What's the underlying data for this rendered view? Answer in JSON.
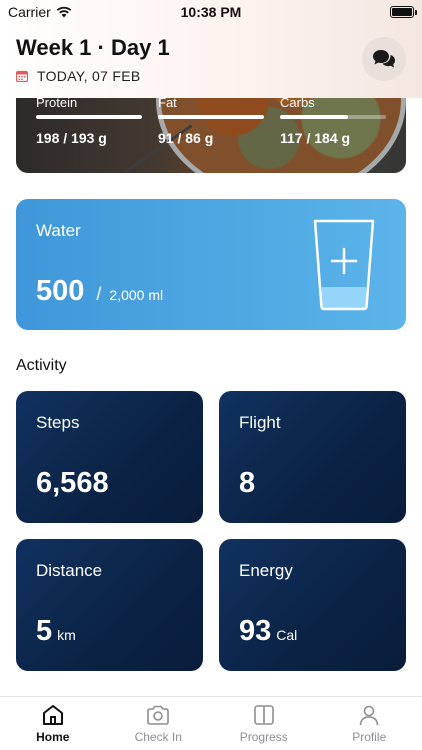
{
  "status_bar": {
    "carrier": "Carrier",
    "time": "10:38 PM"
  },
  "header": {
    "title": "Week 1 · Day 1",
    "date": "TODAY, 07 FEB"
  },
  "macros": [
    {
      "label": "Protein",
      "value": "198 / 193 g",
      "progress": 1.0
    },
    {
      "label": "Fat",
      "value": "91 / 86 g",
      "progress": 1.0
    },
    {
      "label": "Carbs",
      "value": "117 / 184 g",
      "progress": 0.64
    }
  ],
  "water": {
    "title": "Water",
    "amount": "500",
    "separator": "/",
    "target": "2,000 ml",
    "fill_fraction": 0.25
  },
  "activity": {
    "title": "Activity",
    "steps": {
      "label": "Steps",
      "value": "6,568",
      "unit": ""
    },
    "flight": {
      "label": "Flight",
      "value": "8",
      "unit": ""
    },
    "distance": {
      "label": "Distance",
      "value": "5",
      "unit": "km"
    },
    "energy": {
      "label": "Energy",
      "value": "93",
      "unit": "Cal"
    }
  },
  "tabs": [
    {
      "label": "Home",
      "icon": "home-icon",
      "active": true
    },
    {
      "label": "Check In",
      "icon": "camera-icon",
      "active": false
    },
    {
      "label": "Progress",
      "icon": "columns-icon",
      "active": false
    },
    {
      "label": "Profile",
      "icon": "person-icon",
      "active": false
    }
  ],
  "colors": {
    "water_card": "#4aa6e2",
    "activity_card": "#0b2244",
    "date_icon": "#e05a5a"
  }
}
